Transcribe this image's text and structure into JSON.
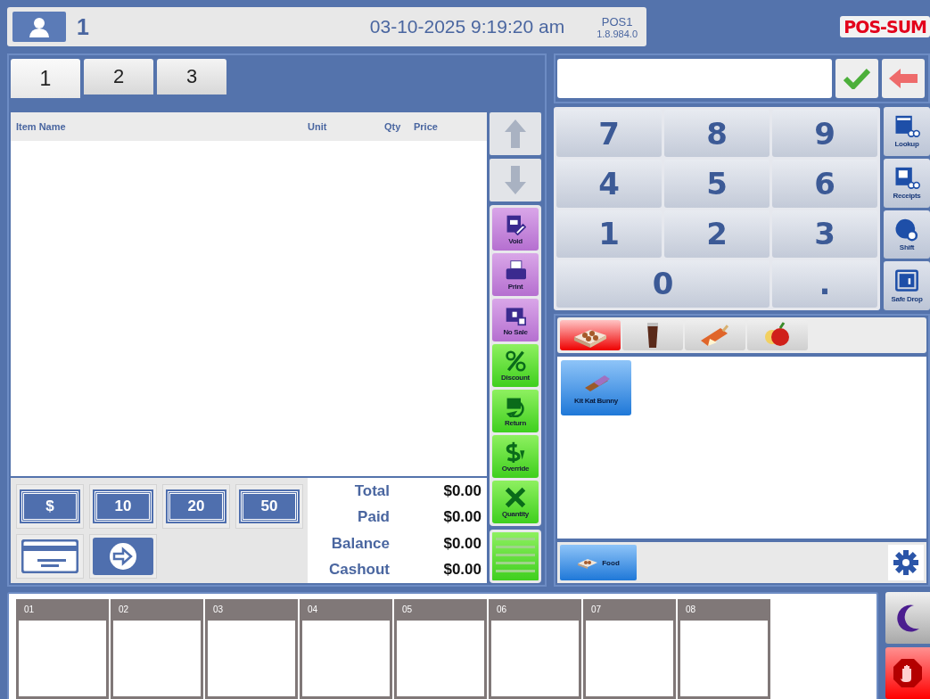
{
  "header": {
    "user_number": "1",
    "datetime": "03-10-2025 9:19:20 am",
    "station": "POS1",
    "version": "1.8.984.0",
    "logo": "POS-SUM"
  },
  "order_tabs": [
    {
      "label": "1",
      "selected": true
    },
    {
      "label": "2",
      "selected": false
    },
    {
      "label": "3",
      "selected": false
    }
  ],
  "order_table": {
    "columns": [
      "Item Name",
      "Unit",
      "Qty",
      "Price"
    ]
  },
  "actions": [
    {
      "label": "Void",
      "kind": "void"
    },
    {
      "label": "Print",
      "kind": "print"
    },
    {
      "label": "No Sale",
      "kind": "nosale"
    },
    {
      "label": "Discount",
      "kind": "discount"
    },
    {
      "label": "Return",
      "kind": "return"
    },
    {
      "label": "Override",
      "kind": "override"
    },
    {
      "label": "Quantity",
      "kind": "quantity"
    }
  ],
  "cash_buttons": [
    {
      "label": "$"
    },
    {
      "label": "10"
    },
    {
      "label": "20"
    },
    {
      "label": "50"
    }
  ],
  "totals": [
    {
      "label": "Total",
      "value": "$0.00"
    },
    {
      "label": "Paid",
      "value": "$0.00"
    },
    {
      "label": "Balance",
      "value": "$0.00"
    },
    {
      "label": "Cashout",
      "value": "$0.00"
    }
  ],
  "keypad": [
    {
      "label": "7",
      "wide": false
    },
    {
      "label": "8",
      "wide": false
    },
    {
      "label": "9",
      "wide": false
    },
    {
      "label": "4",
      "wide": false
    },
    {
      "label": "5",
      "wide": false
    },
    {
      "label": "6",
      "wide": false
    },
    {
      "label": "1",
      "wide": false
    },
    {
      "label": "2",
      "wide": false
    },
    {
      "label": "3",
      "wide": false
    },
    {
      "label": "0",
      "wide": true
    },
    {
      "label": ".",
      "wide": false
    }
  ],
  "side_functions": [
    {
      "label": "Lookup",
      "kind": "lookup"
    },
    {
      "label": "Receipts",
      "kind": "receipts"
    },
    {
      "label": "Shift",
      "kind": "shift"
    },
    {
      "label": "Safe Drop",
      "kind": "safe"
    }
  ],
  "category_tabs": [
    {
      "kind": "pastry",
      "selected": true
    },
    {
      "kind": "drink",
      "selected": false
    },
    {
      "kind": "icecream",
      "selected": false
    },
    {
      "kind": "fruit",
      "selected": false
    }
  ],
  "products": [
    {
      "label": "Kit Kat Bunny"
    }
  ],
  "groups": [
    {
      "label": "Food",
      "selected": true
    }
  ],
  "holds": [
    "01",
    "02",
    "03",
    "04",
    "05",
    "06",
    "07",
    "08"
  ]
}
